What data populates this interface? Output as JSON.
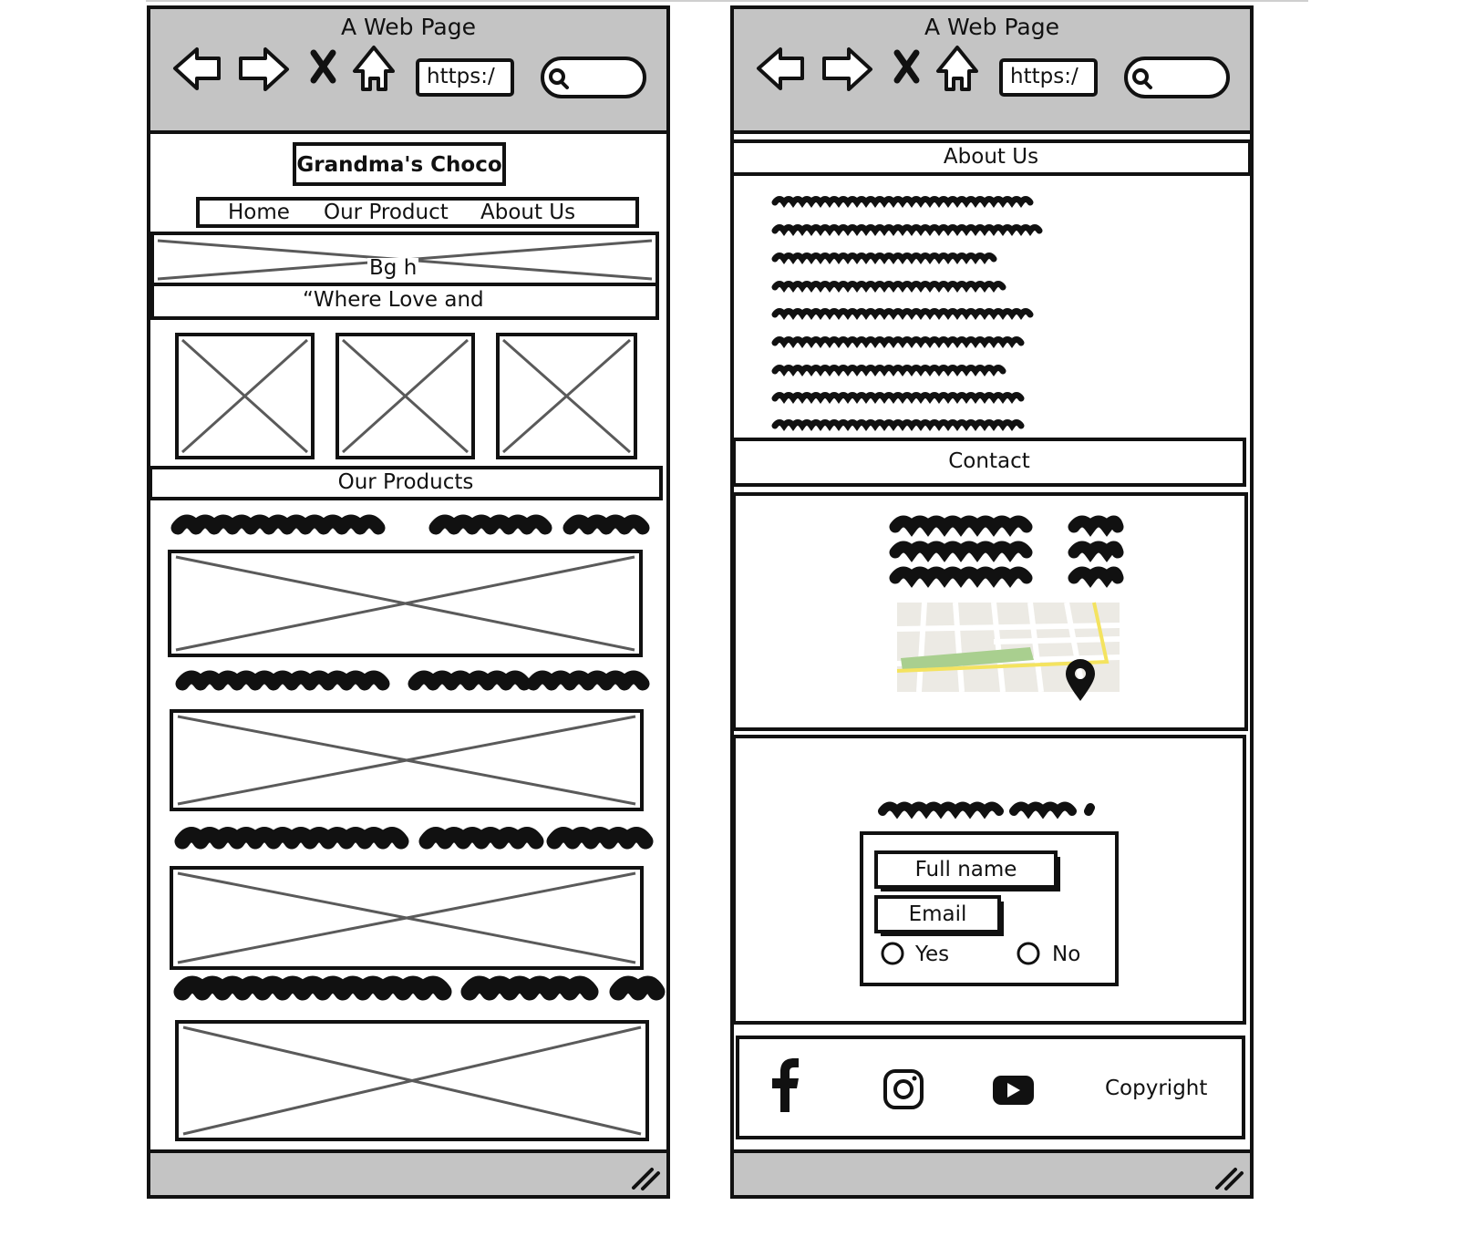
{
  "left_window": {
    "title": "A Web Page",
    "url": "https:/",
    "site": {
      "logo_text": "Grandma's Choco",
      "nav": [
        "Home",
        "Our Product",
        "About Us"
      ],
      "hero_image_label": "Bg h",
      "tagline": "“Where Love and",
      "products_heading": "Our Products"
    }
  },
  "right_window": {
    "title": "A Web Page",
    "url": "https:/",
    "about_heading": "About Us",
    "contact_heading": "Contact",
    "form": {
      "full_name_label": "Full name",
      "email_label": "Email",
      "yes_label": "Yes",
      "no_label": "No"
    },
    "footer": {
      "icons": [
        "facebook-icon",
        "instagram-icon",
        "youtube-icon"
      ],
      "copyright": "Copyright"
    }
  },
  "colors": {
    "chrome": "#c4c4c4",
    "stroke": "#111111",
    "placeholder_x": "#5a5a5a",
    "map_road": "#f4e35f",
    "map_park": "#a9cf8f"
  }
}
